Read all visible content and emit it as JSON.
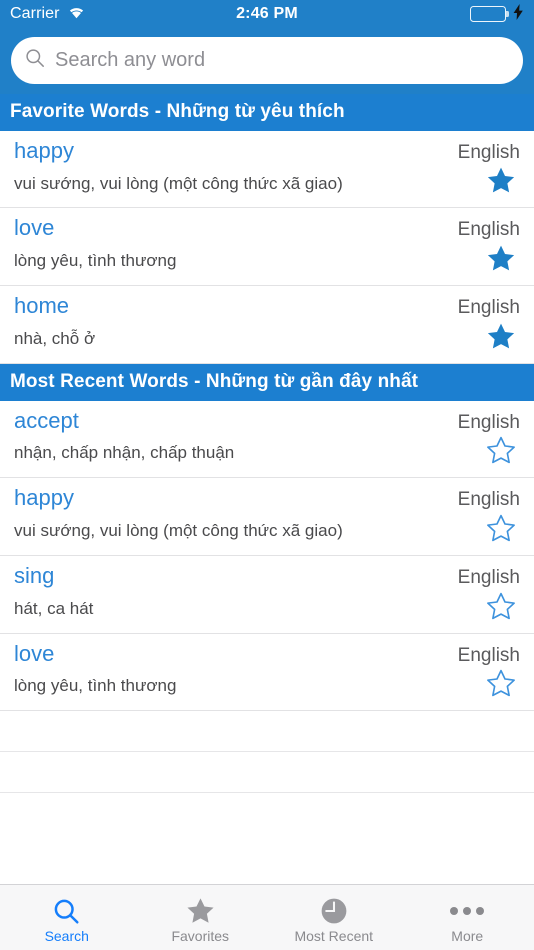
{
  "status_bar": {
    "carrier": "Carrier",
    "time": "2:46 PM",
    "wifi_icon": "wifi-icon",
    "battery_icon": "battery-icon",
    "charging_icon": "lightning-bolt-icon",
    "battery_color": "#4cd964"
  },
  "search": {
    "placeholder": "Search any word",
    "value": "",
    "icon": "search-icon"
  },
  "theme": {
    "header_blue": "#2080c8",
    "section_blue": "#1c7fd0",
    "word_blue": "#2e86d6",
    "star_blue": "#1e7fc6",
    "tab_active": "#157efb",
    "tab_inactive": "#8a8a8e"
  },
  "sections": [
    {
      "title": "Favorite Words - Những từ yêu thích",
      "rows": [
        {
          "word": "happy",
          "language": "English",
          "meaning": "vui sướng, vui lòng (một công thức xã giao)",
          "favorited": true
        },
        {
          "word": "love",
          "language": "English",
          "meaning": "lòng yêu, tình thương",
          "favorited": true
        },
        {
          "word": "home",
          "language": "English",
          "meaning": "nhà, chỗ ở",
          "favorited": true
        }
      ]
    },
    {
      "title": "Most Recent Words - Những từ gần đây nhất",
      "rows": [
        {
          "word": "accept",
          "language": "English",
          "meaning": "nhận, chấp nhận, chấp thuận",
          "favorited": false
        },
        {
          "word": "happy",
          "language": "English",
          "meaning": "vui sướng, vui lòng (một công thức xã giao)",
          "favorited": false
        },
        {
          "word": "sing",
          "language": "English",
          "meaning": "hát, ca hát",
          "favorited": false
        },
        {
          "word": "love",
          "language": "English",
          "meaning": "lòng yêu, tình thương",
          "favorited": false
        }
      ]
    }
  ],
  "empty_rows": 2,
  "tabbar": {
    "items": [
      {
        "label": "Search",
        "icon": "search-icon",
        "active": true
      },
      {
        "label": "Favorites",
        "icon": "star-icon",
        "active": false
      },
      {
        "label": "Most Recent",
        "icon": "clock-icon",
        "active": false
      },
      {
        "label": "More",
        "icon": "ellipsis-icon",
        "active": false
      }
    ]
  }
}
